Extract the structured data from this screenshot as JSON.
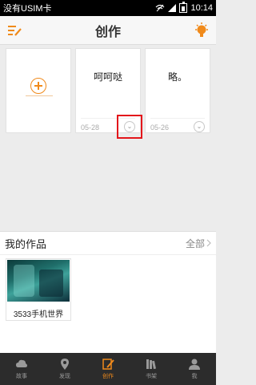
{
  "status_bar": {
    "carrier": "没有USIM卡",
    "time": "10:14"
  },
  "header": {
    "title": "创作",
    "left_icon": "edit-list-icon",
    "right_icon": "lightbulb-icon"
  },
  "cards": [
    {
      "title": "呵呵哒",
      "date": "05-28"
    },
    {
      "title": "略。",
      "date": "05-26"
    }
  ],
  "add_card_icon": "add-circle-icon",
  "toggle_icon": "chevron-down-circle-icon",
  "works": {
    "title": "我的作品",
    "all_label": "全部",
    "items": [
      {
        "title": "3533手机世界"
      }
    ]
  },
  "bottom_nav": [
    {
      "label": "故事",
      "icon": "cloud-icon",
      "active": false
    },
    {
      "label": "发现",
      "icon": "location-pin-icon",
      "active": false
    },
    {
      "label": "创作",
      "icon": "pencil-icon",
      "active": true
    },
    {
      "label": "书架",
      "icon": "bookshelf-icon",
      "active": false
    },
    {
      "label": "我",
      "icon": "user-icon",
      "active": false
    }
  ],
  "colors": {
    "accent": "#f08a1b",
    "highlight": "#e3161b",
    "nav_bg": "#2c2c2c"
  }
}
